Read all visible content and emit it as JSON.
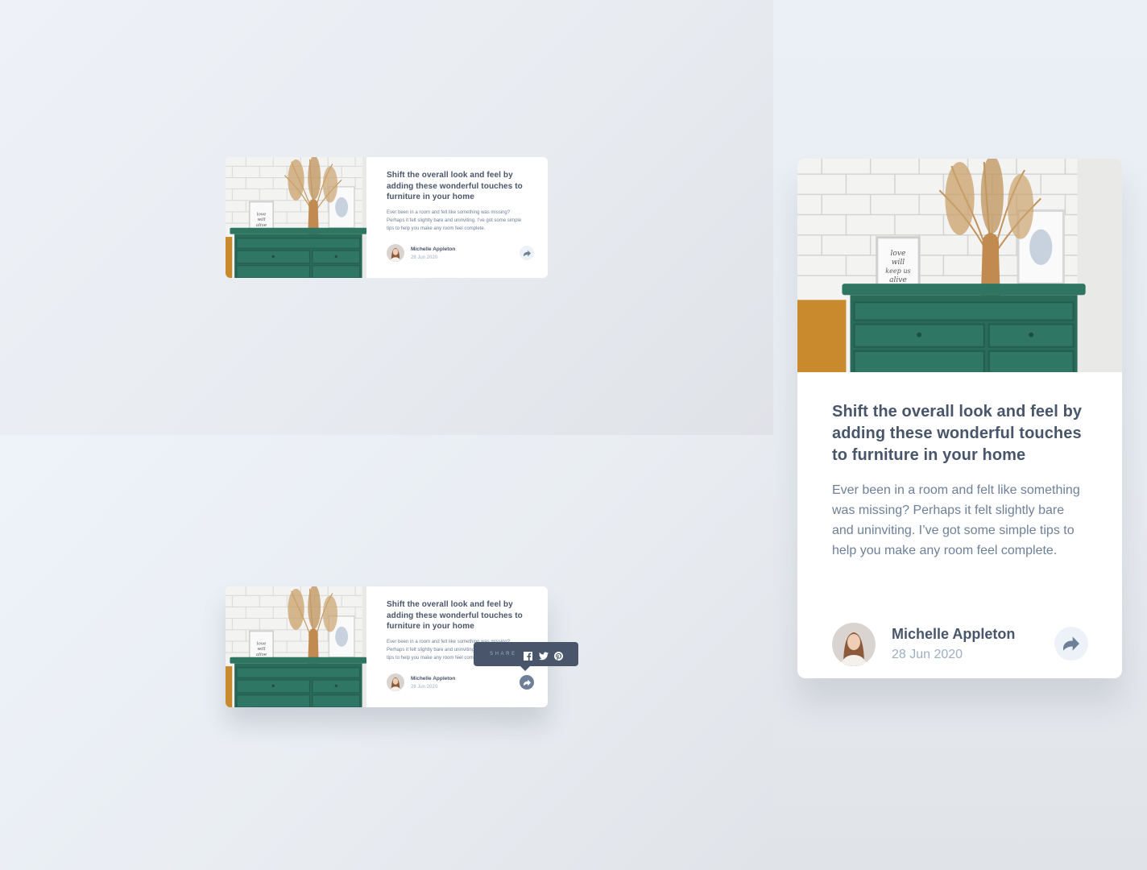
{
  "card": {
    "title": "Shift the overall look and feel by adding these wonderful touches to furniture in your home",
    "description": "Ever been in a room and felt like something was missing? Perhaps it felt slightly bare and uninviting. I’ve got some simple tips to help you make any room feel complete.",
    "author": "Michelle Appleton",
    "date": "28 Jun 2020",
    "frame_text": "love will keep us alive"
  },
  "tooltip": {
    "label": "SHARE",
    "icons": [
      "facebook-icon",
      "twitter-icon",
      "pinterest-icon"
    ]
  },
  "colors": {
    "dark_blue": "#48556a",
    "desaturated_blue": "#6e8098",
    "grayish_blue": "#9daec2",
    "light_grayish_blue": "#ecf2f8",
    "furniture_green": "#2c6e5e"
  }
}
